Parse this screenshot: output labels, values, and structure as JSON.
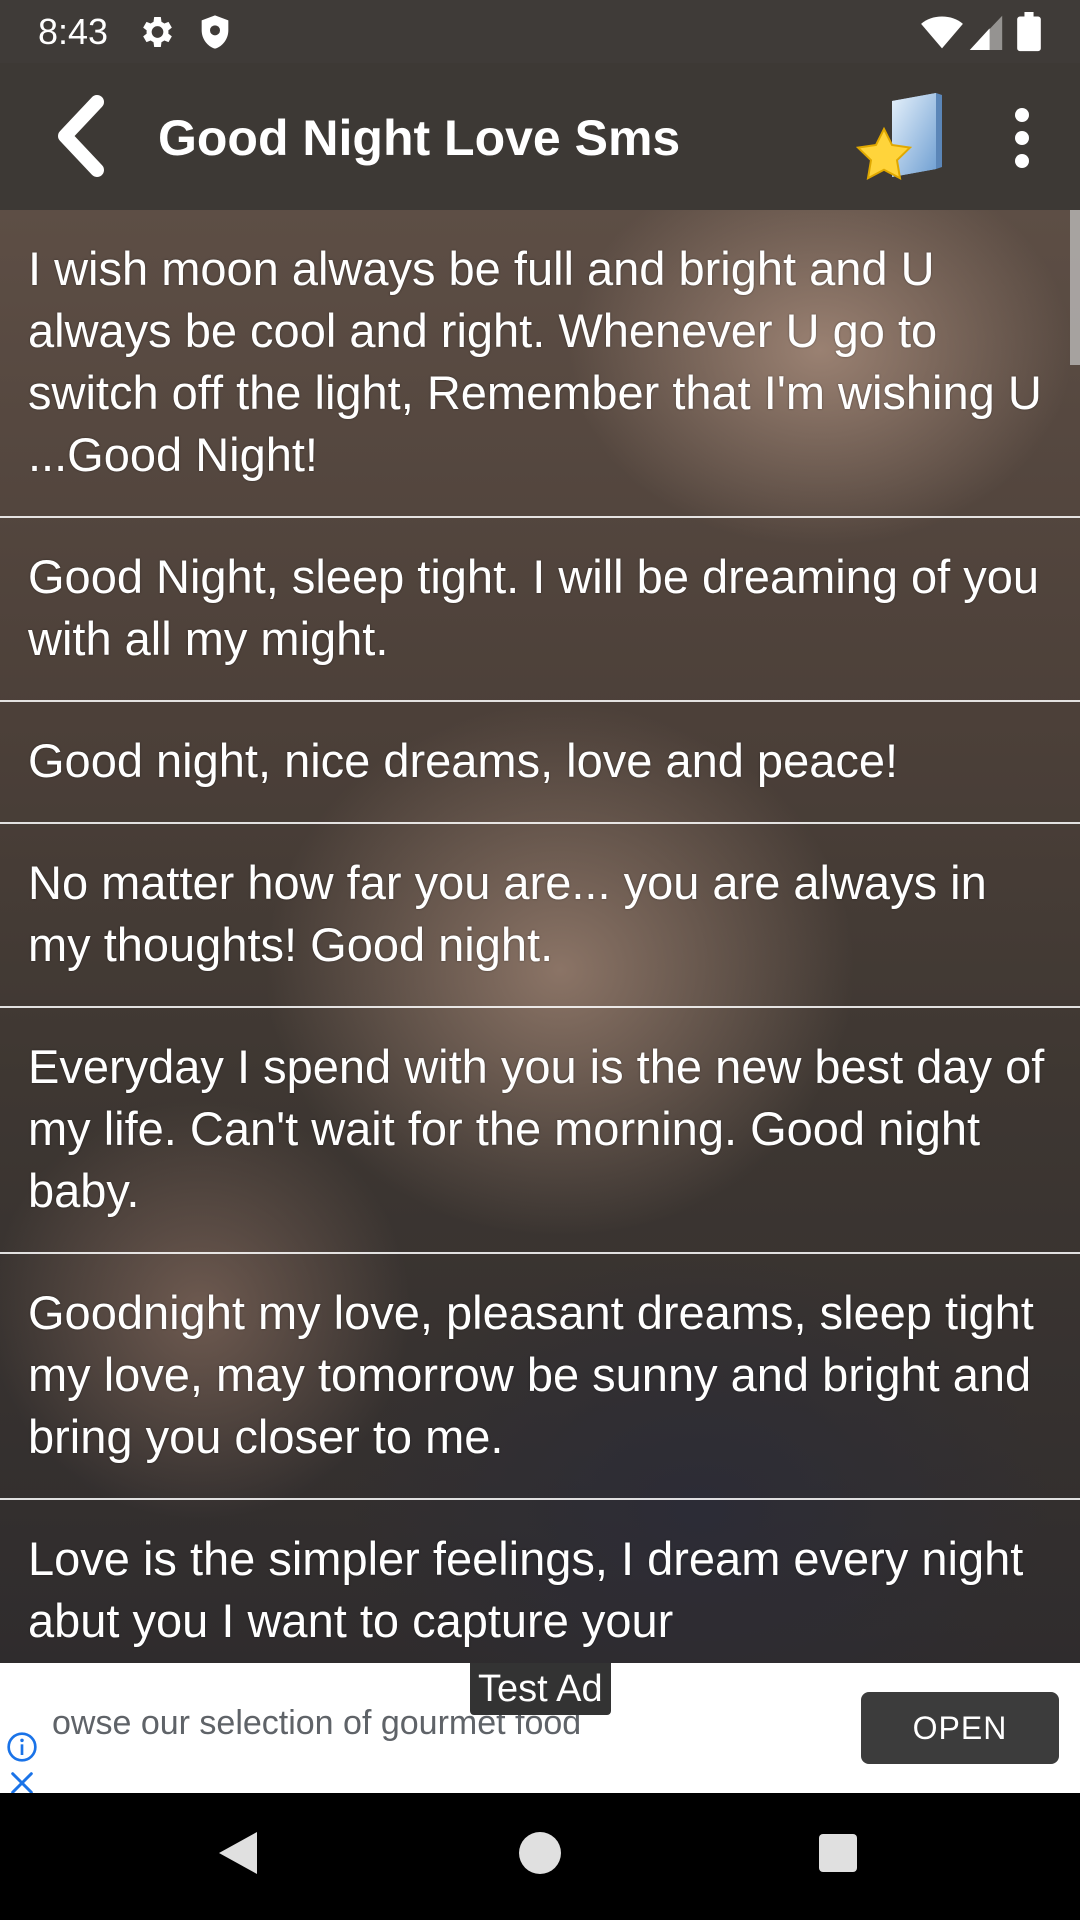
{
  "status_bar": {
    "time": "8:43",
    "icons_left": [
      "settings-icon",
      "shield-icon"
    ],
    "icons_right": [
      "wifi-icon",
      "signal-icon",
      "battery-icon"
    ]
  },
  "app_bar": {
    "title": "Good Night Love Sms",
    "back_icon": "chevron-left-icon",
    "favorites_icon": "star-folder-icon",
    "more_icon": "more-vertical-icon"
  },
  "messages": [
    "I wish moon always be full and bright and U always be cool and right. Whenever U go to switch off the light, Remember that I'm wishing U ...Good Night!",
    "Good Night, sleep tight. I will be dreaming of you with all my might.",
    "Good night, nice dreams, love and peace!",
    "No matter how far you are... you are always in my thoughts! Good night.",
    "Everyday I spend with you is the new best day of my life. Can't wait for the morning. Good night baby.",
    "Goodnight my love, pleasant dreams, sleep tight my love, may tomorrow be sunny and bright and bring you closer to me.",
    "Love is the simpler feelings, I dream every night abut you I want to capture your"
  ],
  "ad": {
    "label": "Test Ad",
    "text": "owse our selection of gourmet food",
    "button": "OPEN",
    "info_icon": "info-icon",
    "close_icon": "close-icon"
  },
  "nav_bar": {
    "back": "back-triangle-icon",
    "home": "home-circle-icon",
    "recents": "recents-square-icon"
  }
}
